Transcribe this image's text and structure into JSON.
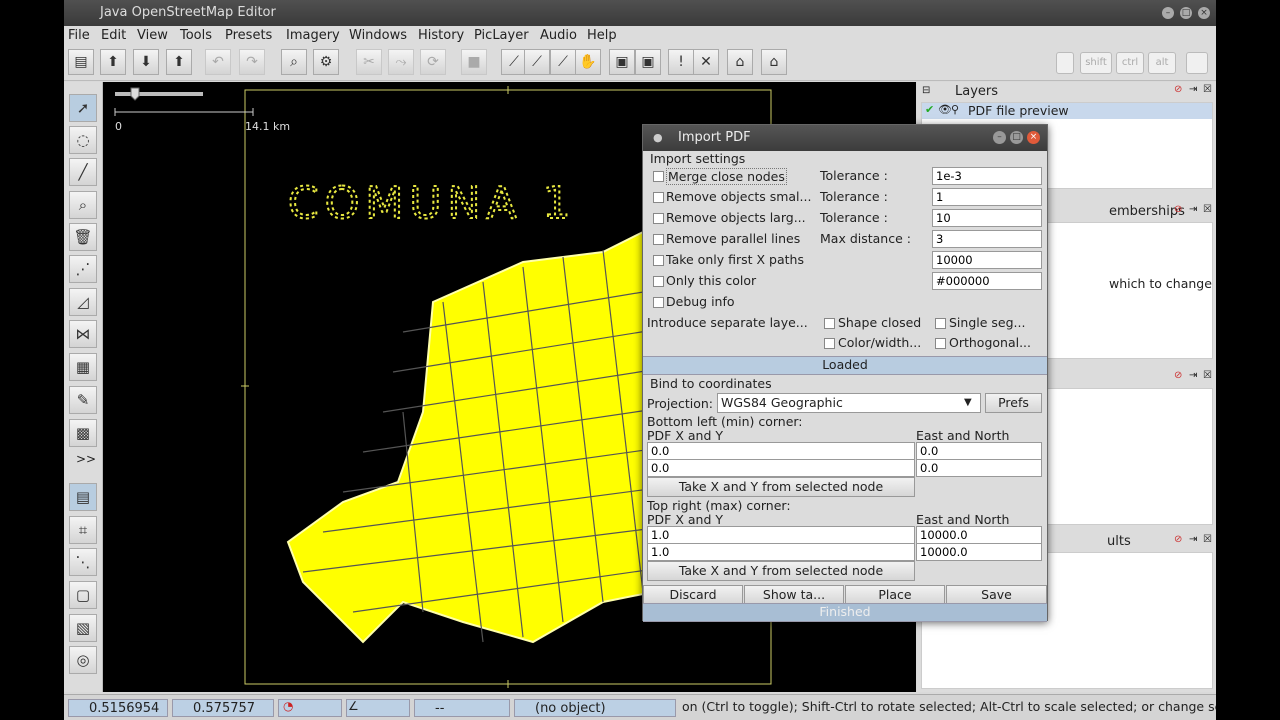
{
  "window": {
    "title": "Java OpenStreetMap Editor"
  },
  "menu": [
    "File",
    "Edit",
    "View",
    "Tools",
    "Presets",
    "Imagery",
    "Windows",
    "History",
    "PicLayer",
    "Audio",
    "Help"
  ],
  "scale": {
    "start": "0",
    "end": "14.1 km"
  },
  "map": {
    "label": "COMUNA 1"
  },
  "left_tools": {
    "more": ">>"
  },
  "layers_panel": {
    "title": "Layers",
    "items": [
      {
        "name": "PDF file preview",
        "selected": true
      }
    ]
  },
  "panel2": {
    "title_partial": "emberships",
    "body_partial": "which to change"
  },
  "panel4": {
    "title_partial": "ults"
  },
  "dialog": {
    "title": "Import PDF",
    "import_settings": "Import settings",
    "options": [
      {
        "label": "Merge close nodes",
        "param": "Tolerance :",
        "value": "1e-3"
      },
      {
        "label": "Remove objects smal...",
        "param": "Tolerance :",
        "value": "1"
      },
      {
        "label": "Remove objects larg...",
        "param": "Tolerance :",
        "value": "10"
      },
      {
        "label": "Remove parallel lines",
        "param": "Max distance :",
        "value": "3"
      },
      {
        "label": "Take only first X paths",
        "param": "",
        "value": "10000"
      },
      {
        "label": "Only this color",
        "param": "",
        "value": "#000000"
      },
      {
        "label": "Debug info",
        "param": "",
        "value": ""
      }
    ],
    "separate_layers": "Introduce separate laye...",
    "sep_options": [
      "Shape closed",
      "Single seg...",
      "Color/width...",
      "Orthogonal..."
    ],
    "loaded": "Loaded",
    "bind": "Bind to coordinates",
    "projection_label": "Projection:",
    "projection_value": "WGS84 Geographic",
    "prefs": "Prefs",
    "bottom_left": "Bottom left (min) corner:",
    "top_right": "Top right (max) corner:",
    "pdf_xy": "PDF X and Y",
    "east_north": "East and North",
    "bl_pdf": [
      "0.0",
      "0.0"
    ],
    "bl_en": [
      "0.0",
      "0.0"
    ],
    "tr_pdf": [
      "1.0",
      "1.0"
    ],
    "tr_en": [
      "10000.0",
      "10000.0"
    ],
    "take_xy": "Take X and Y from selected node",
    "buttons": [
      "Discard",
      "Show ta...",
      "Place",
      "Save"
    ],
    "finished": "Finished"
  },
  "status": {
    "lat": "0.5156954",
    "lon": "0.575757",
    "dist": "--",
    "object": "(no object)",
    "help": "on (Ctrl to toggle); Shift-Ctrl to rotate selected; Alt-Ctrl to scale selected; or change selection"
  }
}
